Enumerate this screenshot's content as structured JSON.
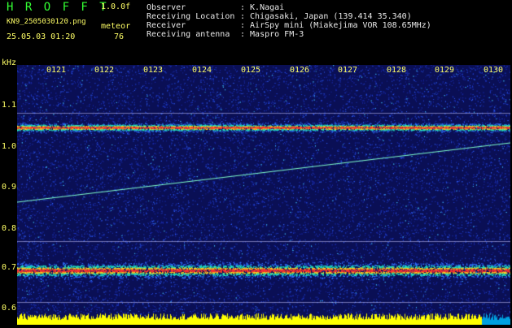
{
  "header": {
    "brand": "H R O F F T",
    "version": "1.0.0f",
    "filename": "KN9_2505030120.png",
    "meteor_label": "meteor",
    "datetime": "25.05.03 01:20",
    "meteor_count": "76"
  },
  "info": [
    {
      "key": "Observer",
      "value": ": K.Nagai"
    },
    {
      "key": "Receiving Location",
      "value": ": Chigasaki, Japan (139.414 35.340)"
    },
    {
      "key": "Receiver",
      "value": ": AirSpy mini (Miakejima VOR 108.65MHz)"
    },
    {
      "key": "Receiving antenna",
      "value": ": Maspro FM-3"
    }
  ],
  "axis": {
    "y_unit": "kHz",
    "y_ticks": [
      "1.1",
      "1.0",
      "0.9",
      "0.8",
      "0.7",
      "0.6"
    ],
    "x_ticks": [
      "0121",
      "0122",
      "0123",
      "0124",
      "0125",
      "0126",
      "0127",
      "0128",
      "0129",
      "0130"
    ]
  },
  "colors": {
    "background": "#000000",
    "noise": "#1a2aa8",
    "band": "#ff3030",
    "band_glow": "#20e0c0",
    "trace": "#80ffcc",
    "strip": "#ffff00",
    "strip_alt": "#00d0ff"
  }
}
